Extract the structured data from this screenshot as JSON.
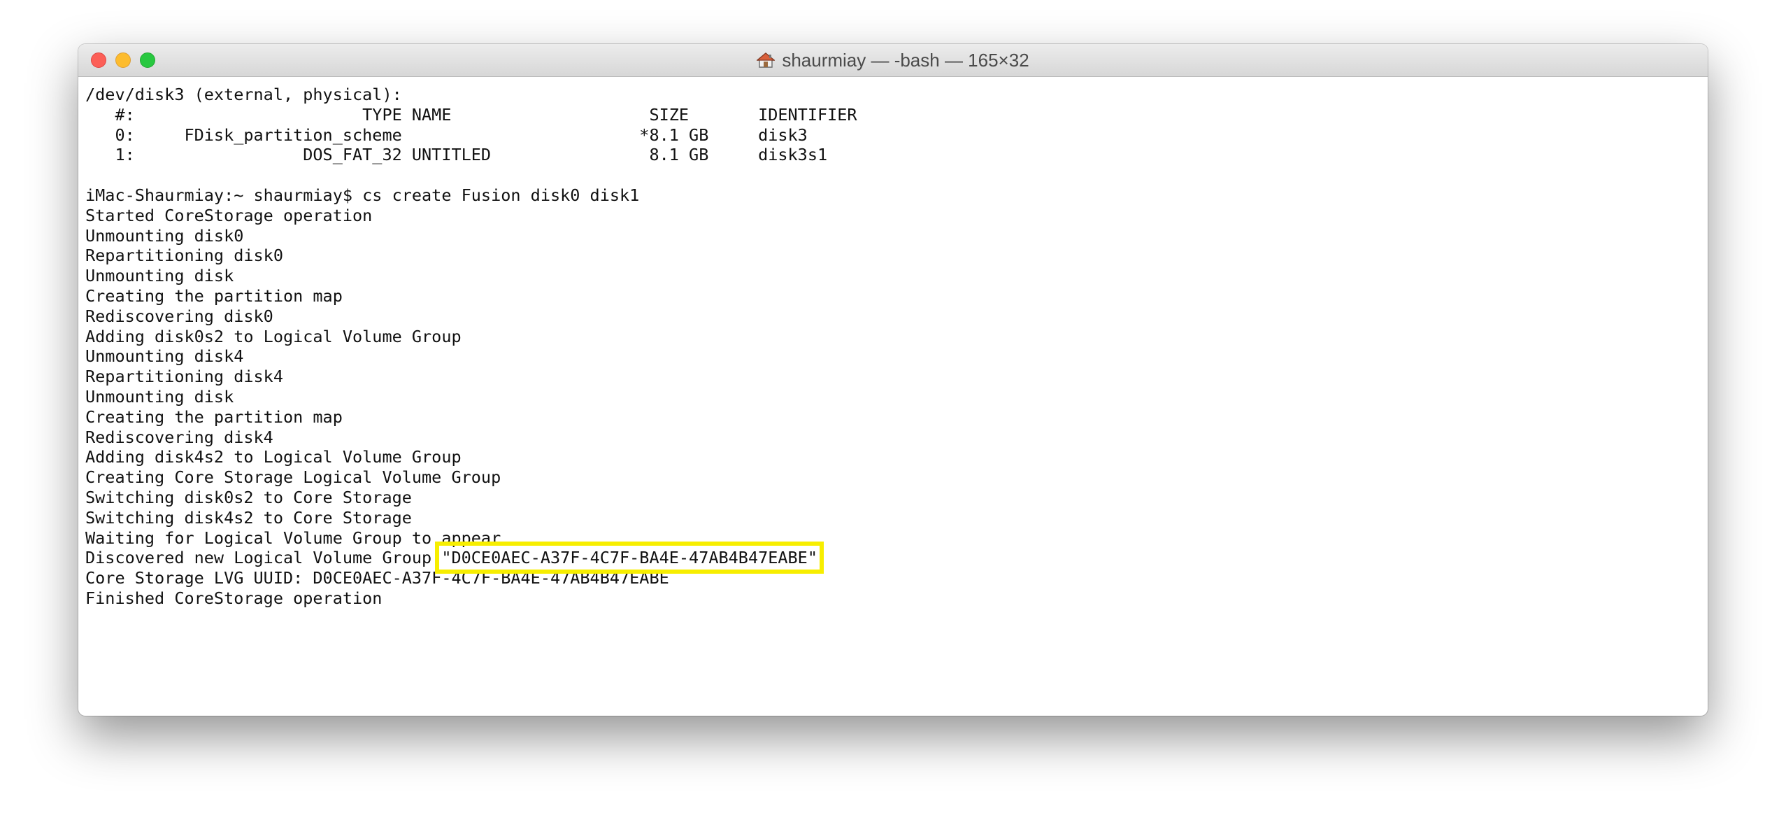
{
  "window": {
    "title": "shaurmiay — -bash — 165×32",
    "title_icon": "home-icon"
  },
  "terminal": {
    "lines": [
      "/dev/disk3 (external, physical):",
      "   #:                       TYPE NAME                    SIZE       IDENTIFIER",
      "   0:     FDisk_partition_scheme                        *8.1 GB     disk3",
      "   1:                 DOS_FAT_32 UNTITLED                8.1 GB     disk3s1",
      "",
      "iMac-Shaurmiay:~ shaurmiay$ cs create Fusion disk0 disk1",
      "Started CoreStorage operation",
      "Unmounting disk0",
      "Repartitioning disk0",
      "Unmounting disk",
      "Creating the partition map",
      "Rediscovering disk0",
      "Adding disk0s2 to Logical Volume Group",
      "Unmounting disk4",
      "Repartitioning disk4",
      "Unmounting disk",
      "Creating the partition map",
      "Rediscovering disk4",
      "Adding disk4s2 to Logical Volume Group",
      "Creating Core Storage Logical Volume Group",
      "Switching disk0s2 to Core Storage",
      "Switching disk4s2 to Core Storage",
      "Waiting for Logical Volume Group to appear"
    ],
    "discovered_prefix": "Discovered new Logical Volume Group ",
    "discovered_uuid": "\"D0CE0AEC-A37F-4C7F-BA4E-47AB4B47EABE\"",
    "lines_after": [
      "Core Storage LVG UUID: D0CE0AEC-A37F-4C7F-BA4E-47AB4B47EABE",
      "Finished CoreStorage operation"
    ],
    "highlight_color": "#f7ee00"
  }
}
